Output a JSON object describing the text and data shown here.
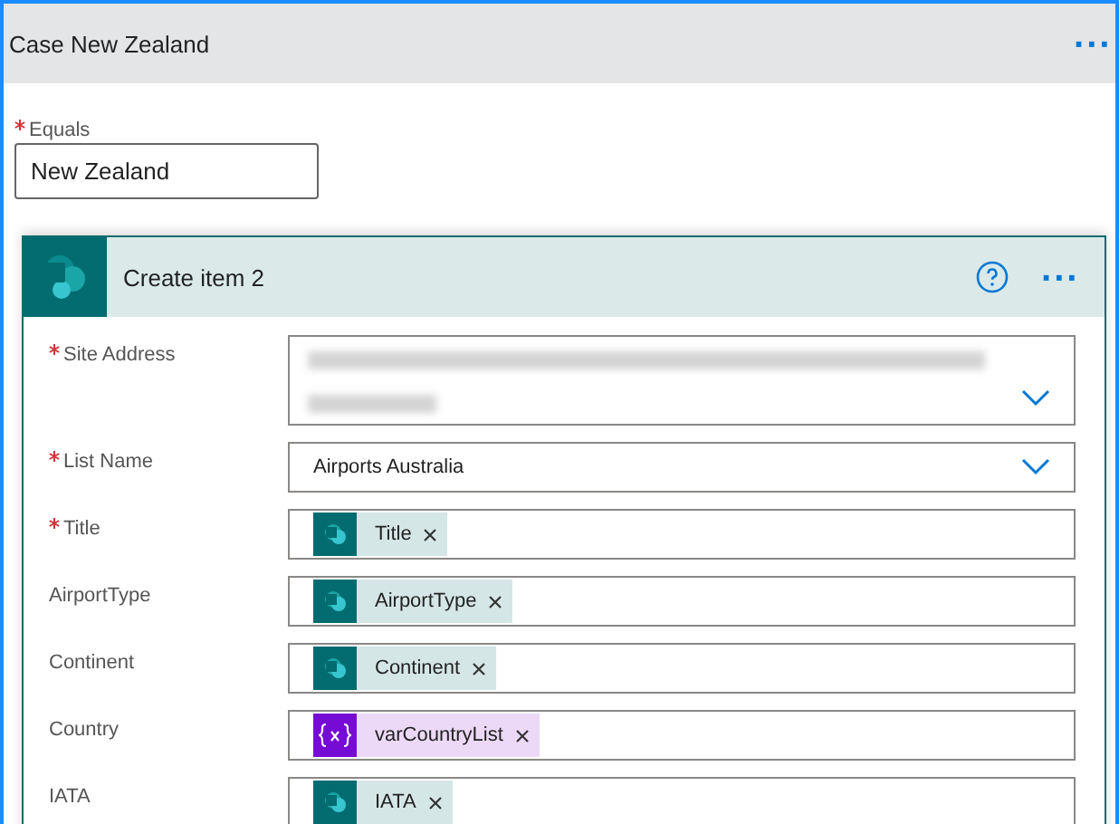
{
  "case": {
    "title": "Case New Zealand",
    "menu": "···"
  },
  "equals": {
    "label": "Equals",
    "required": true,
    "value": "New Zealand"
  },
  "action": {
    "title": "Create item 2",
    "menu": "···",
    "fields": [
      {
        "label": "Site Address",
        "required": true,
        "kind": "blurred"
      },
      {
        "label": "List Name",
        "required": true,
        "kind": "dropdown",
        "value": "Airports Australia"
      },
      {
        "label": "Title",
        "required": true,
        "kind": "tokens",
        "tokens": [
          {
            "kind": "sharepoint",
            "text": "Title"
          }
        ]
      },
      {
        "label": "AirportType",
        "required": false,
        "kind": "tokens",
        "tokens": [
          {
            "kind": "sharepoint",
            "text": "AirportType"
          }
        ]
      },
      {
        "label": "Continent",
        "required": false,
        "kind": "tokens",
        "tokens": [
          {
            "kind": "sharepoint",
            "text": "Continent"
          }
        ]
      },
      {
        "label": "Country",
        "required": false,
        "kind": "tokens",
        "tokens": [
          {
            "kind": "variable",
            "text": "varCountryList"
          }
        ]
      },
      {
        "label": "IATA",
        "required": false,
        "kind": "tokens",
        "tokens": [
          {
            "kind": "sharepoint",
            "text": "IATA"
          }
        ]
      }
    ]
  }
}
